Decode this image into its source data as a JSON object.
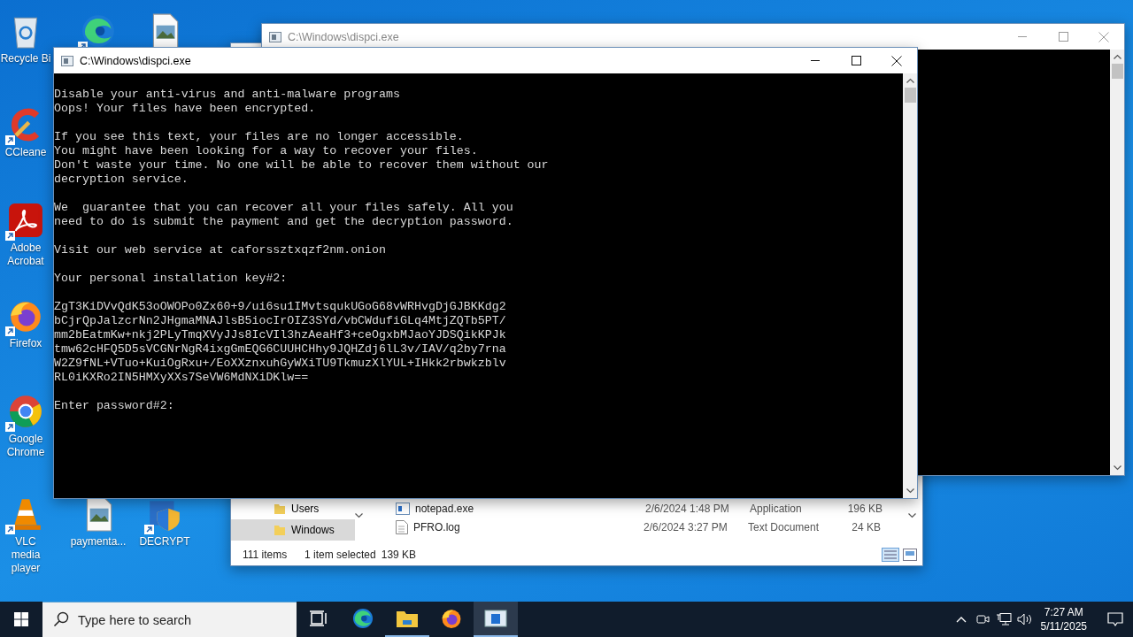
{
  "desktop_icons": [
    {
      "kind": "recycle_bin",
      "label": "Recycle Bi",
      "shortcut": false
    },
    {
      "kind": "edge",
      "shortcut": true
    },
    {
      "kind": "image_file",
      "shortcut": false
    },
    {
      "kind": "ccleaner",
      "label": "CCleane",
      "shortcut": true
    },
    {
      "kind": "acrobat",
      "label": "Adobe Acrobat",
      "shortcut": true
    },
    {
      "kind": "firefox",
      "label": "Firefox",
      "shortcut": true
    },
    {
      "kind": "chrome",
      "label": "Google Chrome",
      "shortcut": true
    },
    {
      "kind": "vlc",
      "label": "VLC media player",
      "shortcut": true
    },
    {
      "kind": "image_file",
      "label": "paymenta...",
      "shortcut": false
    },
    {
      "kind": "decrypt",
      "label": "DECRYPT",
      "shortcut": true
    }
  ],
  "explorer": {
    "nav_items": [
      {
        "label": "Users",
        "selected": false
      },
      {
        "label": "Windows",
        "selected": true
      }
    ],
    "files": [
      {
        "kind": "exe",
        "name": "notepad.exe",
        "date": "2/6/2024 1:48 PM",
        "type": "Application",
        "size": "196 KB"
      },
      {
        "kind": "log",
        "name": "PFRO.log",
        "date": "2/6/2024 3:27 PM",
        "type": "Text Document",
        "size": "24 KB"
      }
    ],
    "status": {
      "count": "111 items",
      "selection": "1 item selected",
      "size": "139 KB"
    }
  },
  "back_console": {
    "title": "C:\\Windows\\dispci.exe"
  },
  "console": {
    "title": "C:\\Windows\\dispci.exe",
    "paragraphs": [
      [
        "Disable your anti-virus and anti-malware programs",
        "Oops! Your files have been encrypted."
      ],
      [
        "If you see this text, your files are no longer accessible.",
        "You might have been looking for a way to recover your files.",
        "Don't waste your time. No one will be able to recover them without our",
        "decryption service."
      ],
      [
        "We  guarantee that you can recover all your files safely. All you",
        "need to do is submit the payment and get the decryption password."
      ],
      [
        "Visit our web service at caforssztxqzf2nm.onion"
      ],
      [
        "Your personal installation key#2:"
      ],
      [
        "ZgT3KiDVvQdK53oOWOPo0Zx60+9/ui6su1IMvtsqukUGoG68vWRHvgDjGJBKKdg2",
        "bCjrQpJalzcrNn2JHgmaMNAJlsB5iocIrOIZ3SYd/vbCWdufiGLq4MtjZQTb5PT/",
        "mm2bEatmKw+nkj2PLyTmqXVyJJs8IcVIl3hzAeaHf3+ceOgxbMJaoYJDSQikKPJk",
        "tmw62cHFQ5D5sVCGNrNgR4ixgGmEQG6CUUHCHhy9JQHZdj6lL3v/IAV/q2by7rna",
        "W2Z9fNL+VTuo+KuiOgRxu+/EoXXznxuhGyWXiTU9TkmuzXlYUL+IHkk2rbwkzblv",
        "RL0iKXRo2IN5HMXyXXs7SeVW6MdNXiDKlw=="
      ],
      [
        "Enter password#2:"
      ]
    ]
  },
  "taskbar": {
    "search": {
      "placeholder": "Type here to search"
    },
    "apps": [
      {
        "kind": "task_view",
        "running": false,
        "selected": false
      },
      {
        "kind": "edge",
        "running": false,
        "selected": false
      },
      {
        "kind": "explorer",
        "running": true,
        "selected": false
      },
      {
        "kind": "firefox",
        "running": false,
        "selected": false
      },
      {
        "kind": "console",
        "running": true,
        "selected": true
      }
    ],
    "time": "7:27 AM",
    "date": "5/11/2025"
  }
}
